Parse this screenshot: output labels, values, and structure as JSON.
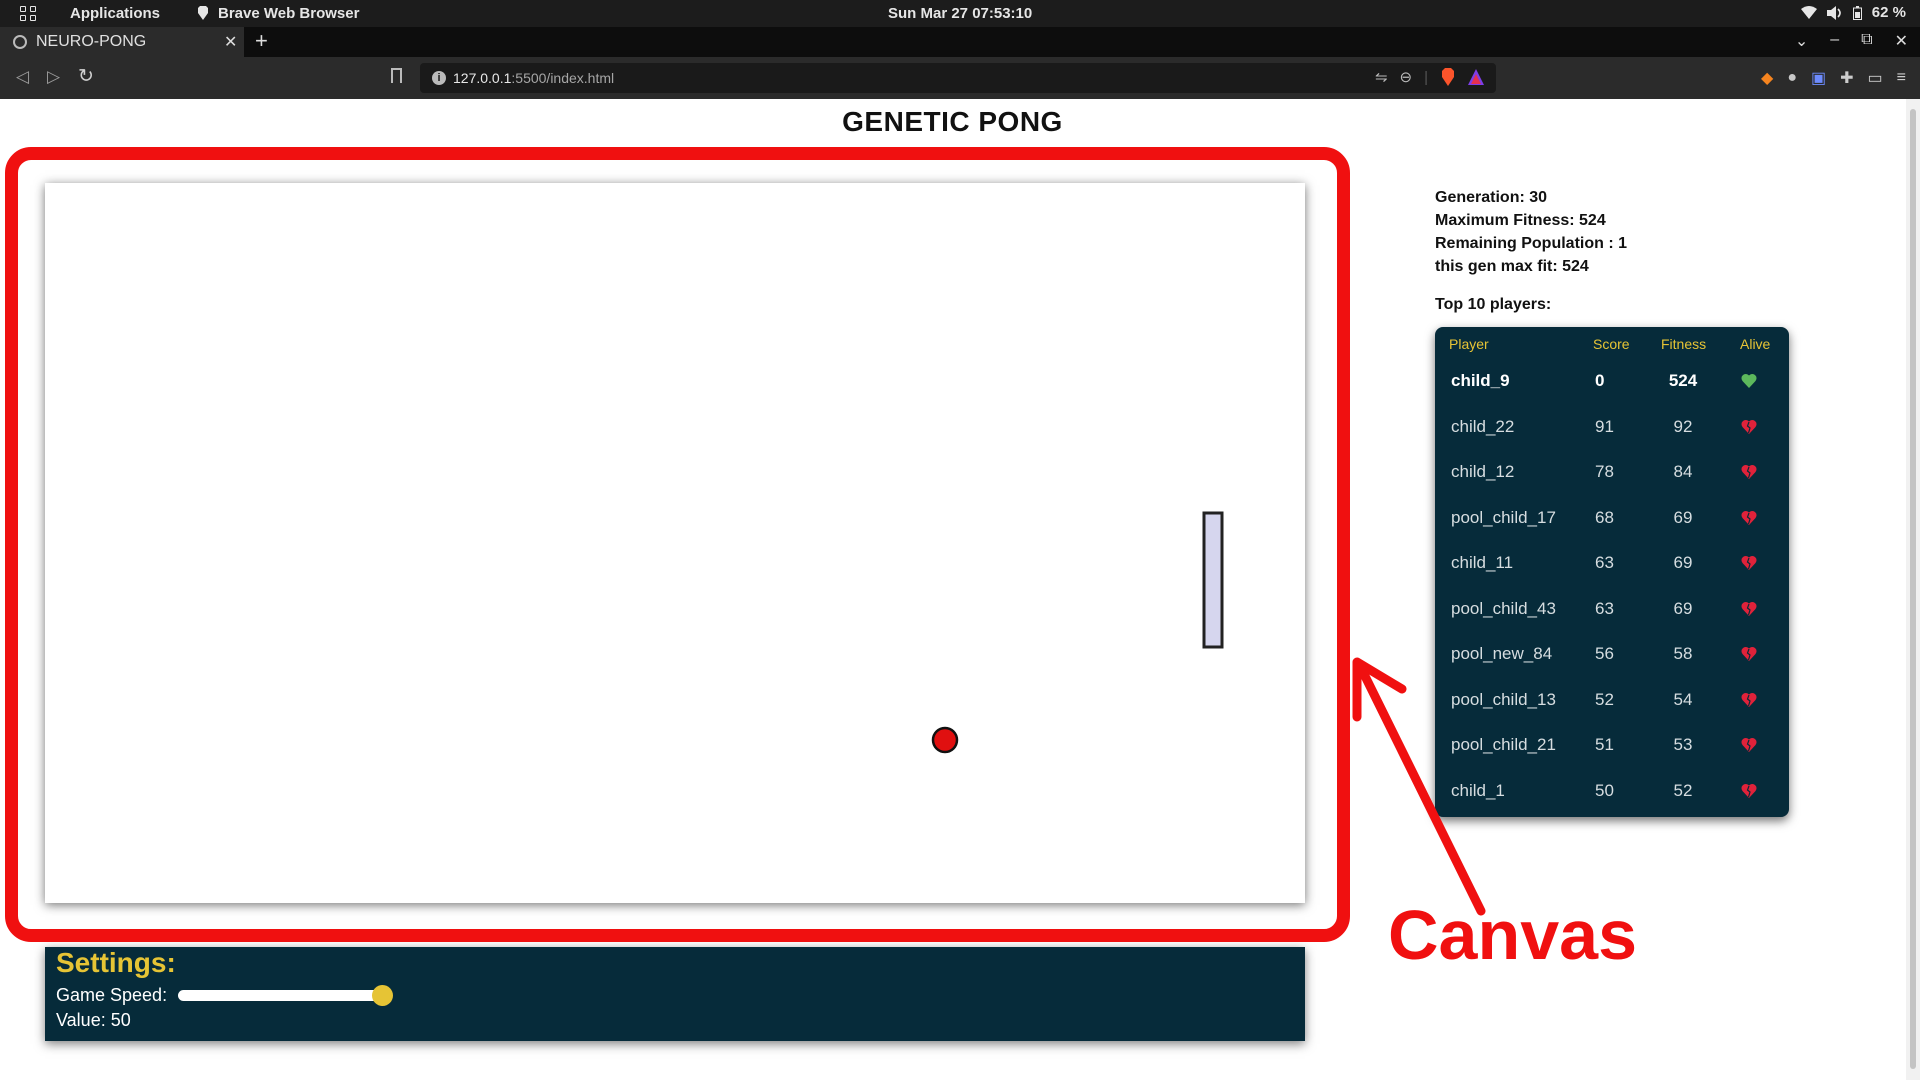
{
  "os_bar": {
    "apps_label": "Applications",
    "app_name": "Brave Web Browser",
    "clock": "Sun Mar 27  07:53:10",
    "battery": "62 %"
  },
  "browser": {
    "tab_title": "NEURO-PONG",
    "url_host": "127.0.0.1",
    "url_rest": ":5500/index.html"
  },
  "page": {
    "title": "GENETIC PONG",
    "stats": {
      "generation": "Generation: 30",
      "max_fitness": "Maximum Fitness: 524",
      "remaining": "Remaining Population : 1",
      "gen_max": "this gen max fit: 524"
    },
    "top_label": "Top 10 players:",
    "leaderboard": {
      "headers": {
        "player": "Player",
        "score": "Score",
        "fitness": "Fitness",
        "alive": "Alive"
      },
      "rows": [
        {
          "player": "child_9",
          "score": "0",
          "fitness": "524",
          "alive": true
        },
        {
          "player": "child_22",
          "score": "91",
          "fitness": "92",
          "alive": false
        },
        {
          "player": "child_12",
          "score": "78",
          "fitness": "84",
          "alive": false
        },
        {
          "player": "pool_child_17",
          "score": "68",
          "fitness": "69",
          "alive": false
        },
        {
          "player": "child_11",
          "score": "63",
          "fitness": "69",
          "alive": false
        },
        {
          "player": "pool_child_43",
          "score": "63",
          "fitness": "69",
          "alive": false
        },
        {
          "player": "pool_new_84",
          "score": "56",
          "fitness": "58",
          "alive": false
        },
        {
          "player": "pool_child_13",
          "score": "52",
          "fitness": "54",
          "alive": false
        },
        {
          "player": "pool_child_21",
          "score": "51",
          "fitness": "53",
          "alive": false
        },
        {
          "player": "child_1",
          "score": "50",
          "fitness": "52",
          "alive": false
        }
      ]
    },
    "settings": {
      "heading": "Settings:",
      "speed_label": "Game Speed:",
      "value_line": "Value: 50",
      "speed_value": 50
    }
  },
  "annotation": {
    "label": "Canvas"
  },
  "colors": {
    "panel_bg": "#062b3a",
    "accent_yellow": "#e6c435",
    "annotation_red": "#f01010",
    "alive_heart": "#5cb85c",
    "dead_heart": "#e0223a",
    "ball": "#e01010",
    "paddle": "#d6d6ee"
  }
}
